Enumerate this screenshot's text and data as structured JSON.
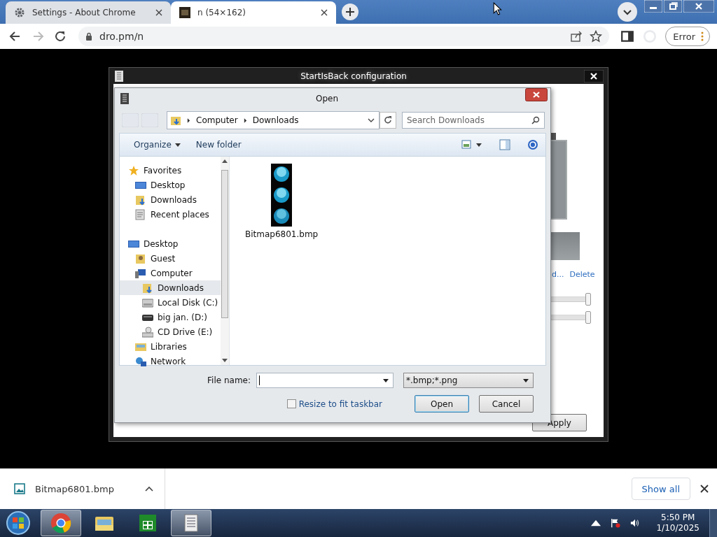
{
  "browser": {
    "tabs": [
      {
        "title": "Settings - About Chrome",
        "selected": false,
        "kind": "settings"
      },
      {
        "title": "n (54×162)",
        "selected": true,
        "kind": "image"
      }
    ],
    "url": "dro.pm/n",
    "profile_button": "Error"
  },
  "config_window": {
    "title": "StartIsBack configuration",
    "links": [
      "d...",
      "Delete"
    ],
    "sliders": [
      {
        "level": 1
      },
      {
        "level": 1
      }
    ],
    "buttons": [
      "Apply"
    ]
  },
  "open_dialog": {
    "title": "Open",
    "breadcrumb": [
      "Computer",
      "Downloads"
    ],
    "search": {
      "placeholder": "Search Downloads"
    },
    "toolbar": [
      "Organize",
      "New folder"
    ],
    "nav": [
      {
        "label": "Favorites",
        "kind": "star",
        "selected": false,
        "children": [
          {
            "label": "Desktop",
            "kind": "desktop",
            "selected": false
          },
          {
            "label": "Downloads",
            "kind": "downloads",
            "selected": false
          },
          {
            "label": "Recent places",
            "kind": "recent",
            "selected": false
          }
        ]
      },
      {
        "label": "Desktop",
        "kind": "desktop",
        "selected": false,
        "children": [
          {
            "label": "Guest",
            "kind": "user",
            "selected": false
          },
          {
            "label": "Computer",
            "kind": "computer",
            "selected": false,
            "children": [
              {
                "label": "Downloads",
                "kind": "downloads",
                "selected": true
              },
              {
                "label": "Local Disk (C:)",
                "kind": "disk",
                "selected": false
              },
              {
                "label": "big jan. (D:)",
                "kind": "drive",
                "selected": false
              },
              {
                "label": "CD Drive (E:)",
                "kind": "cd",
                "selected": false
              }
            ]
          },
          {
            "label": "Libraries",
            "kind": "libraries",
            "selected": false
          },
          {
            "label": "Network",
            "kind": "network",
            "selected": false
          }
        ]
      }
    ],
    "files": [
      {
        "name": "Bitmap6801.bmp"
      }
    ],
    "file_name_label": "File name:",
    "file_type": "*.bmp;*.png",
    "checkbox": {
      "label": "Resize to fit taskbar",
      "checked": false
    },
    "buttons": [
      "Open",
      "Cancel"
    ]
  },
  "downloads": {
    "items": [
      {
        "name": "Bitmap6801.bmp"
      }
    ],
    "show_all": "Show all"
  },
  "taskbar": {
    "apps": [
      {
        "kind": "chrome",
        "active": true
      },
      {
        "kind": "explorer",
        "active": false
      },
      {
        "kind": "store",
        "active": false
      },
      {
        "kind": "config",
        "active": true
      }
    ],
    "time": "5:50 PM",
    "date": "1/10/2025"
  }
}
